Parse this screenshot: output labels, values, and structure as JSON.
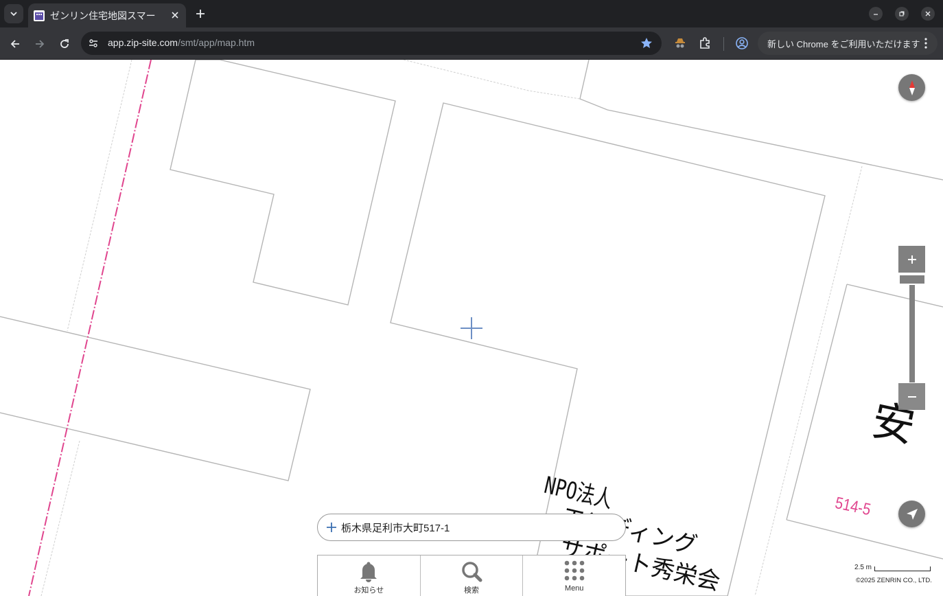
{
  "browser": {
    "tab_title": "ゼンリン住宅地図スマー",
    "url_host": "app.zip-site.com",
    "url_path": "/smt/app/map.htm",
    "update_chip_label": "新しい Chrome をご利用いただけます"
  },
  "map": {
    "labels": {
      "npo": "NPO法人",
      "ending": "エンディング",
      "support": "サポート秀栄会",
      "building_partial": "安",
      "parcel_number": "514-5"
    },
    "address_bar": {
      "text": "栃木県足利市大町517-1"
    },
    "bottom_nav": [
      {
        "label": "お知らせ",
        "icon": "bell-icon"
      },
      {
        "label": "検索",
        "icon": "search-icon"
      },
      {
        "label": "Menu",
        "icon": "grid-menu-icon"
      }
    ],
    "scale_label": "2.5 m",
    "copyright": "©2025 ZENRIN CO., LTD."
  },
  "colors": {
    "railway_line": "#e0458e",
    "crosshair": "#6d8fc4",
    "control_gray": "#808080",
    "compass_needle": "#e53935"
  }
}
